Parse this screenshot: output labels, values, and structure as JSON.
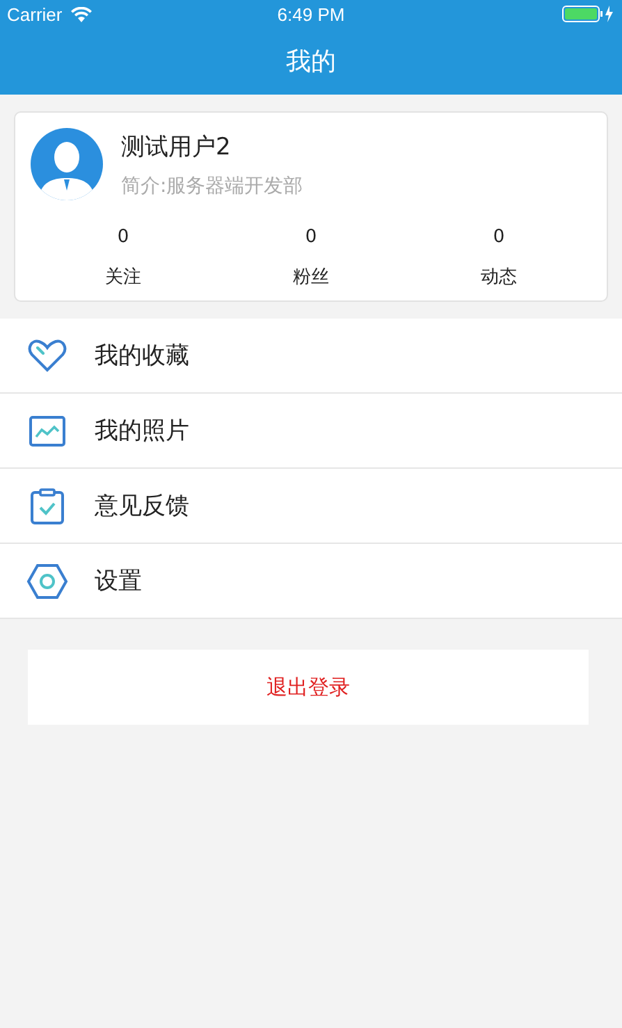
{
  "status_bar": {
    "carrier": "Carrier",
    "time": "6:49 PM"
  },
  "nav_bar": {
    "title": "我的"
  },
  "profile": {
    "name": "测试用户2",
    "bio": "简介:服务器端开发部",
    "stats": [
      {
        "value": "0",
        "label": "关注"
      },
      {
        "value": "0",
        "label": "粉丝"
      },
      {
        "value": "0",
        "label": "动态"
      }
    ]
  },
  "menu": [
    {
      "kind": "favorites",
      "label": "我的收藏"
    },
    {
      "kind": "photos",
      "label": "我的照片"
    },
    {
      "kind": "feedback",
      "label": "意见反馈"
    },
    {
      "kind": "settings",
      "label": "设置"
    }
  ],
  "logout_button": "退出登录"
}
